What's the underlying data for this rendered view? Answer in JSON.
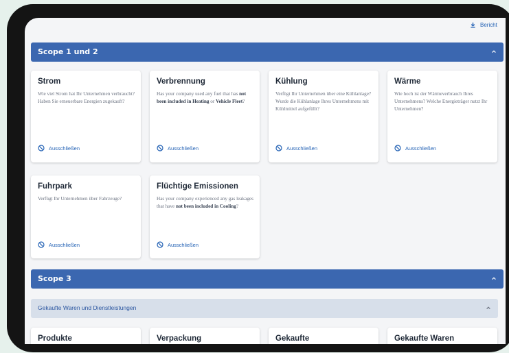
{
  "toolbar": {
    "report_label": "Bericht"
  },
  "sections": [
    {
      "title": "Scope 1 und 2"
    },
    {
      "title": "Scope 3"
    }
  ],
  "subsection": {
    "title": "Gekaufte Waren und Dienstleistungen"
  },
  "exclude_label": "Ausschließen",
  "cards": [
    {
      "title": "Strom",
      "desc": [
        "Wie viel Strom hat Ihr Unternehmen verbraucht? Haben Sie erneuerbare Energien zugekauft?"
      ]
    },
    {
      "title": "Verbrennung",
      "desc": [
        "Has your company used any fuel that has ",
        "not been included in Heating",
        " or ",
        "Vehicle Fleet",
        "?"
      ]
    },
    {
      "title": "Kühlung",
      "desc": [
        "Verfügt Ihr Unternehmen über eine Kühlanlage? Wurde die Kühlanlage Ihres Unternehmens mit Kühlmittel aufgefüllt?"
      ]
    },
    {
      "title": "Wärme",
      "desc": [
        "Wie hoch ist der Wärmeverbrauch Ihres Unternehmens? Welche Energieträger nutzt Ihr Unternehmen?"
      ]
    },
    {
      "title": "Fuhrpark",
      "desc": [
        "Verfügt Ihr Unternehmen über Fahrzeuge?"
      ]
    },
    {
      "title": "Flüchtige Emissionen",
      "desc": [
        "Has your company experienced any gas leakages that have ",
        "not been included in Cooling",
        "?"
      ]
    }
  ],
  "scope3_cards": [
    {
      "title": "Produkte"
    },
    {
      "title": "Verpackung"
    },
    {
      "title": "Gekaufte"
    },
    {
      "title": "Gekaufte Waren"
    }
  ],
  "colors": {
    "accent": "#3b67b0",
    "link": "#2563b5",
    "subsection_bg": "#d7dfea",
    "backdrop": "#e6f1ec"
  },
  "icons": {
    "report": "download-icon",
    "collapse": "chevron-up-icon",
    "exclude": "block-icon"
  }
}
